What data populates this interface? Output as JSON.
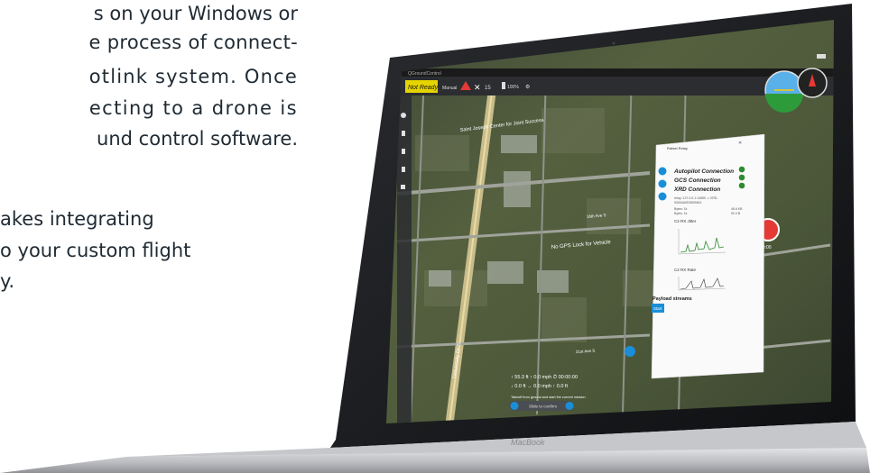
{
  "marketing": {
    "lines": [
      "s on your Windows or",
      "e process of connect-",
      "otlink system. Once",
      "ecting to a drone is",
      "und control software.",
      "akes integrating",
      "o your custom flight",
      "y."
    ]
  },
  "laptop": {
    "brand": "MacBook"
  },
  "app": {
    "title": "QGroundControl",
    "status": "Not Ready",
    "mode": "Manual",
    "sats": "15",
    "battery": "100%",
    "map_labels": [
      "Saint Joseph Center for Joint Success",
      "No GPS Lock for Vehicle",
      "16th Ave S",
      "21st Ave S",
      "University Dr S"
    ],
    "telemetry": {
      "line1": "↑ 55.3 ft  ↑ 0.0 mph  ⏱ 00:00:00",
      "line2": "↓ 0.0 ft  → 0.0 mph  ↑ 0.0 ft",
      "hint": "Takeoff from ground and start the current mission",
      "slider": "Slide to confirm"
    },
    "record_time": "00:00"
  },
  "dialog": {
    "title": "Rafael Relay",
    "connections": [
      "Autopilot Connection",
      "GCS Connection",
      "XRD Connection"
    ],
    "info_lines": [
      "relay: 127.0.0.1:14550 -> XRD-",
      "00004A0D0B09601",
      "Bytes: 1k",
      "Bytes: 1k"
    ],
    "chart1_title": "C2 RX Jitter",
    "chart1_side": "46.6 KB",
    "chart1_side2": "92.0 B",
    "chart2_title": "C2 RX Rate",
    "payload_title": "Payload streams",
    "start_label": "Start"
  },
  "colors": {
    "accent": "#1a8fd8",
    "status_green": "#2e8b2e",
    "record_red": "#e53935",
    "status_yellow": "#e6d400"
  }
}
